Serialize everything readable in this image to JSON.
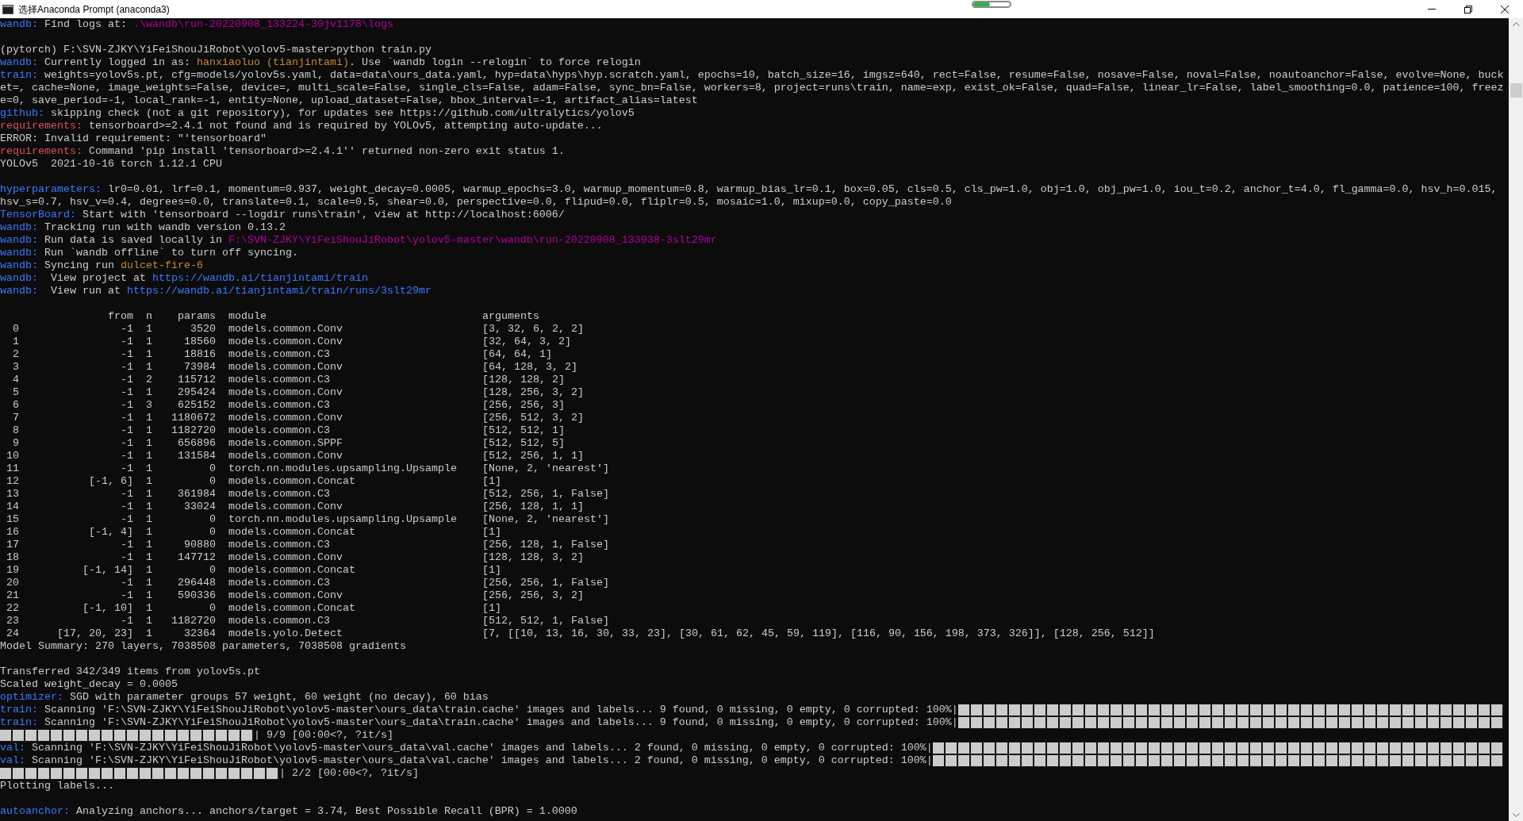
{
  "window": {
    "title": "选择Anaconda Prompt (anaconda3)"
  },
  "capture_indicator": {
    "level": 0.45
  },
  "console": {
    "lines_before_table": [
      {
        "kind": "text",
        "segments": [
          {
            "kind": "label",
            "text": "wandb:"
          },
          {
            "kind": "plain",
            "text": " Find logs at: "
          },
          {
            "kind": "path",
            "text": ".\\wandb\\run-20220908_133224-30jv1178\\logs"
          }
        ]
      },
      {
        "kind": "blank"
      },
      {
        "kind": "text",
        "segments": [
          {
            "kind": "plain",
            "text": "(pytorch) F:\\SVN-ZJKY\\YiFeiShouJiRobot\\yolov5-master>python train.py"
          }
        ]
      },
      {
        "kind": "text",
        "segments": [
          {
            "kind": "label",
            "text": "wandb:"
          },
          {
            "kind": "plain",
            "text": " Currently logged in as: "
          },
          {
            "kind": "name",
            "text": "hanxiaoluo (tianjintami)"
          },
          {
            "kind": "plain",
            "text": ". Use `wandb login --relogin` to force relogin"
          }
        ]
      },
      {
        "kind": "text",
        "segments": [
          {
            "kind": "label",
            "text": "train:"
          },
          {
            "kind": "plain",
            "text": " weights=yolov5s.pt, cfg=models/yolov5s.yaml, data=data\\ours_data.yaml, hyp=data\\hyps\\hyp.scratch.yaml, epochs=10, batch_size=16, imgsz=640, rect=False, resume=False, nosave=False, noval=False, noautoanchor=False, evolve=None, buck"
          }
        ]
      },
      {
        "kind": "text",
        "segments": [
          {
            "kind": "plain",
            "text": "et=, cache=None, image_weights=False, device=, multi_scale=False, single_cls=False, adam=False, sync_bn=False, workers=8, project=runs\\train, name=exp, exist_ok=False, quad=False, linear_lr=False, label_smoothing=0.0, patience=100, freez"
          }
        ]
      },
      {
        "kind": "text",
        "segments": [
          {
            "kind": "plain",
            "text": "e=0, save_period=-1, local_rank=-1, entity=None, upload_dataset=False, bbox_interval=-1, artifact_alias=latest"
          }
        ]
      },
      {
        "kind": "text",
        "segments": [
          {
            "kind": "label",
            "text": "github:"
          },
          {
            "kind": "plain",
            "text": " skipping check (not a git repository), for updates see https://github.com/ultralytics/yolov5"
          }
        ]
      },
      {
        "kind": "text",
        "segments": [
          {
            "kind": "alert",
            "text": "requirements:"
          },
          {
            "kind": "plain",
            "text": " tensorboard>=2.4.1 not found and is required by YOLOv5, attempting auto-update..."
          }
        ]
      },
      {
        "kind": "text",
        "segments": [
          {
            "kind": "plain",
            "text": "ERROR: Invalid requirement: \"'tensorboard\""
          }
        ]
      },
      {
        "kind": "text",
        "segments": [
          {
            "kind": "alert",
            "text": "requirements:"
          },
          {
            "kind": "plain",
            "text": " Command 'pip install 'tensorboard>=2.4.1'' returned non-zero exit status 1."
          }
        ]
      },
      {
        "kind": "text",
        "segments": [
          {
            "kind": "plain",
            "text": "YOLOv5  2021-10-16 torch 1.12.1 CPU"
          }
        ]
      },
      {
        "kind": "blank"
      },
      {
        "kind": "text",
        "segments": [
          {
            "kind": "label",
            "text": "hyperparameters:"
          },
          {
            "kind": "plain",
            "text": " lr0=0.01, lrf=0.1, momentum=0.937, weight_decay=0.0005, warmup_epochs=3.0, warmup_momentum=0.8, warmup_bias_lr=0.1, box=0.05, cls=0.5, cls_pw=1.0, obj=1.0, obj_pw=1.0, iou_t=0.2, anchor_t=4.0, fl_gamma=0.0, hsv_h=0.015,"
          }
        ]
      },
      {
        "kind": "text",
        "segments": [
          {
            "kind": "plain",
            "text": "hsv_s=0.7, hsv_v=0.4, degrees=0.0, translate=0.1, scale=0.5, shear=0.0, perspective=0.0, flipud=0.0, fliplr=0.5, mosaic=1.0, mixup=0.0, copy_paste=0.0"
          }
        ]
      },
      {
        "kind": "text",
        "segments": [
          {
            "kind": "label",
            "text": "TensorBoard:"
          },
          {
            "kind": "plain",
            "text": " Start with 'tensorboard --logdir runs\\train', view at http://localhost:6006/"
          }
        ]
      },
      {
        "kind": "text",
        "segments": [
          {
            "kind": "label",
            "text": "wandb:"
          },
          {
            "kind": "plain",
            "text": " Tracking run with wandb version 0.13.2"
          }
        ]
      },
      {
        "kind": "text",
        "segments": [
          {
            "kind": "label",
            "text": "wandb:"
          },
          {
            "kind": "plain",
            "text": " Run data is saved locally in "
          },
          {
            "kind": "path",
            "text": "F:\\SVN-ZJKY\\YiFeiShouJiRobot\\yolov5-master\\wandb\\run-20220908_133938-3slt29mr"
          }
        ]
      },
      {
        "kind": "text",
        "segments": [
          {
            "kind": "label",
            "text": "wandb:"
          },
          {
            "kind": "plain",
            "text": " Run `wandb offline` to turn off syncing."
          }
        ]
      },
      {
        "kind": "text",
        "segments": [
          {
            "kind": "label",
            "text": "wandb:"
          },
          {
            "kind": "plain",
            "text": " Syncing run "
          },
          {
            "kind": "name",
            "text": "dulcet-fire-6"
          }
        ]
      },
      {
        "kind": "text",
        "segments": [
          {
            "kind": "label",
            "text": "wandb:"
          },
          {
            "kind": "plain",
            "text": "  View project at "
          },
          {
            "kind": "link",
            "text": "https://wandb.ai/tianjintami/train"
          }
        ]
      },
      {
        "kind": "text",
        "segments": [
          {
            "kind": "label",
            "text": "wandb:"
          },
          {
            "kind": "plain",
            "text": "  View run at "
          },
          {
            "kind": "link",
            "text": "https://wandb.ai/tianjintami/train/runs/3slt29mr"
          }
        ]
      },
      {
        "kind": "blank"
      }
    ],
    "model_table": {
      "columns": [
        "",
        "from",
        "n",
        "params",
        "module",
        "arguments"
      ],
      "rows": [
        [
          "0",
          "-1",
          "1",
          "3520",
          "models.common.Conv",
          "[3, 32, 6, 2, 2]"
        ],
        [
          "1",
          "-1",
          "1",
          "18560",
          "models.common.Conv",
          "[32, 64, 3, 2]"
        ],
        [
          "2",
          "-1",
          "1",
          "18816",
          "models.common.C3",
          "[64, 64, 1]"
        ],
        [
          "3",
          "-1",
          "1",
          "73984",
          "models.common.Conv",
          "[64, 128, 3, 2]"
        ],
        [
          "4",
          "-1",
          "2",
          "115712",
          "models.common.C3",
          "[128, 128, 2]"
        ],
        [
          "5",
          "-1",
          "1",
          "295424",
          "models.common.Conv",
          "[128, 256, 3, 2]"
        ],
        [
          "6",
          "-1",
          "3",
          "625152",
          "models.common.C3",
          "[256, 256, 3]"
        ],
        [
          "7",
          "-1",
          "1",
          "1180672",
          "models.common.Conv",
          "[256, 512, 3, 2]"
        ],
        [
          "8",
          "-1",
          "1",
          "1182720",
          "models.common.C3",
          "[512, 512, 1]"
        ],
        [
          "9",
          "-1",
          "1",
          "656896",
          "models.common.SPPF",
          "[512, 512, 5]"
        ],
        [
          "10",
          "-1",
          "1",
          "131584",
          "models.common.Conv",
          "[512, 256, 1, 1]"
        ],
        [
          "11",
          "-1",
          "1",
          "0",
          "torch.nn.modules.upsampling.Upsample",
          "[None, 2, 'nearest']"
        ],
        [
          "12",
          "[-1, 6]",
          "1",
          "0",
          "models.common.Concat",
          "[1]"
        ],
        [
          "13",
          "-1",
          "1",
          "361984",
          "models.common.C3",
          "[512, 256, 1, False]"
        ],
        [
          "14",
          "-1",
          "1",
          "33024",
          "models.common.Conv",
          "[256, 128, 1, 1]"
        ],
        [
          "15",
          "-1",
          "1",
          "0",
          "torch.nn.modules.upsampling.Upsample",
          "[None, 2, 'nearest']"
        ],
        [
          "16",
          "[-1, 4]",
          "1",
          "0",
          "models.common.Concat",
          "[1]"
        ],
        [
          "17",
          "-1",
          "1",
          "90880",
          "models.common.C3",
          "[256, 128, 1, False]"
        ],
        [
          "18",
          "-1",
          "1",
          "147712",
          "models.common.Conv",
          "[128, 128, 3, 2]"
        ],
        [
          "19",
          "[-1, 14]",
          "1",
          "0",
          "models.common.Concat",
          "[1]"
        ],
        [
          "20",
          "-1",
          "1",
          "296448",
          "models.common.C3",
          "[256, 256, 1, False]"
        ],
        [
          "21",
          "-1",
          "1",
          "590336",
          "models.common.Conv",
          "[256, 256, 3, 2]"
        ],
        [
          "22",
          "[-1, 10]",
          "1",
          "0",
          "models.common.Concat",
          "[1]"
        ],
        [
          "23",
          "-1",
          "1",
          "1182720",
          "models.common.C3",
          "[512, 512, 1, False]"
        ],
        [
          "24",
          "[17, 20, 23]",
          "1",
          "32364",
          "models.yolo.Detect",
          "[7, [[10, 13, 16, 30, 33, 23], [30, 61, 62, 45, 59, 119], [116, 90, 156, 198, 373, 326]], [128, 256, 512]]"
        ]
      ]
    },
    "lines_after_table": [
      {
        "kind": "text",
        "segments": [
          {
            "kind": "plain",
            "text": "Model Summary: 270 layers, 7038508 parameters, 7038508 gradients"
          }
        ]
      },
      {
        "kind": "blank"
      },
      {
        "kind": "text",
        "segments": [
          {
            "kind": "plain",
            "text": "Transferred 342/349 items from yolov5s.pt"
          }
        ]
      },
      {
        "kind": "text",
        "segments": [
          {
            "kind": "plain",
            "text": "Scaled weight_decay = 0.0005"
          }
        ]
      },
      {
        "kind": "text",
        "segments": [
          {
            "kind": "label",
            "text": "optimizer:"
          },
          {
            "kind": "plain",
            "text": " SGD with parameter groups 57 weight, 60 weight (no decay), 60 bias"
          }
        ]
      },
      {
        "kind": "text",
        "segments": [
          {
            "kind": "label",
            "text": "train:"
          },
          {
            "kind": "plain",
            "text": " Scanning 'F:\\SVN-ZJKY\\YiFeiShouJiRobot\\yolov5-master\\ours_data\\train.cache' images and labels... 9 found, 0 missing, 0 empty, 0 corrupted: 100%|"
          },
          {
            "kind": "bar",
            "level": 1
          }
        ]
      },
      {
        "kind": "text",
        "segments": [
          {
            "kind": "label",
            "text": "train:"
          },
          {
            "kind": "plain",
            "text": " Scanning 'F:\\SVN-ZJKY\\YiFeiShouJiRobot\\yolov5-master\\ours_data\\train.cache' images and labels... 9 found, 0 missing, 0 empty, 0 corrupted: 100%|"
          },
          {
            "kind": "bar",
            "level": 1
          }
        ]
      },
      {
        "kind": "text",
        "segments": [
          {
            "kind": "bar",
            "level": 1
          },
          {
            "kind": "plain",
            "text": "| 9/9 [00:00<?, ?it/s]"
          }
        ]
      },
      {
        "kind": "text",
        "segments": [
          {
            "kind": "label",
            "text": "val:"
          },
          {
            "kind": "plain",
            "text": " Scanning 'F:\\SVN-ZJKY\\YiFeiShouJiRobot\\yolov5-master\\ours_data\\val.cache' images and labels... 2 found, 0 missing, 0 empty, 0 corrupted: 100%|"
          },
          {
            "kind": "bar",
            "level": 1
          }
        ]
      },
      {
        "kind": "text",
        "segments": [
          {
            "kind": "label",
            "text": "val:"
          },
          {
            "kind": "plain",
            "text": " Scanning 'F:\\SVN-ZJKY\\YiFeiShouJiRobot\\yolov5-master\\ours_data\\val.cache' images and labels... 2 found, 0 missing, 0 empty, 0 corrupted: 100%|"
          },
          {
            "kind": "bar",
            "level": 1
          }
        ]
      },
      {
        "kind": "text",
        "segments": [
          {
            "kind": "bar",
            "level": 1
          },
          {
            "kind": "plain",
            "text": "| 2/2 [00:00<?, ?it/s]"
          }
        ]
      },
      {
        "kind": "text",
        "segments": [
          {
            "kind": "plain",
            "text": "Plotting labels..."
          }
        ]
      },
      {
        "kind": "blank"
      },
      {
        "kind": "text",
        "segments": [
          {
            "kind": "label",
            "text": "autoanchor:"
          },
          {
            "kind": "plain",
            "text": " Analyzing anchors... anchors/target = 3.74, Best Possible Recall (BPR) = 1.0000"
          }
        ]
      }
    ]
  }
}
